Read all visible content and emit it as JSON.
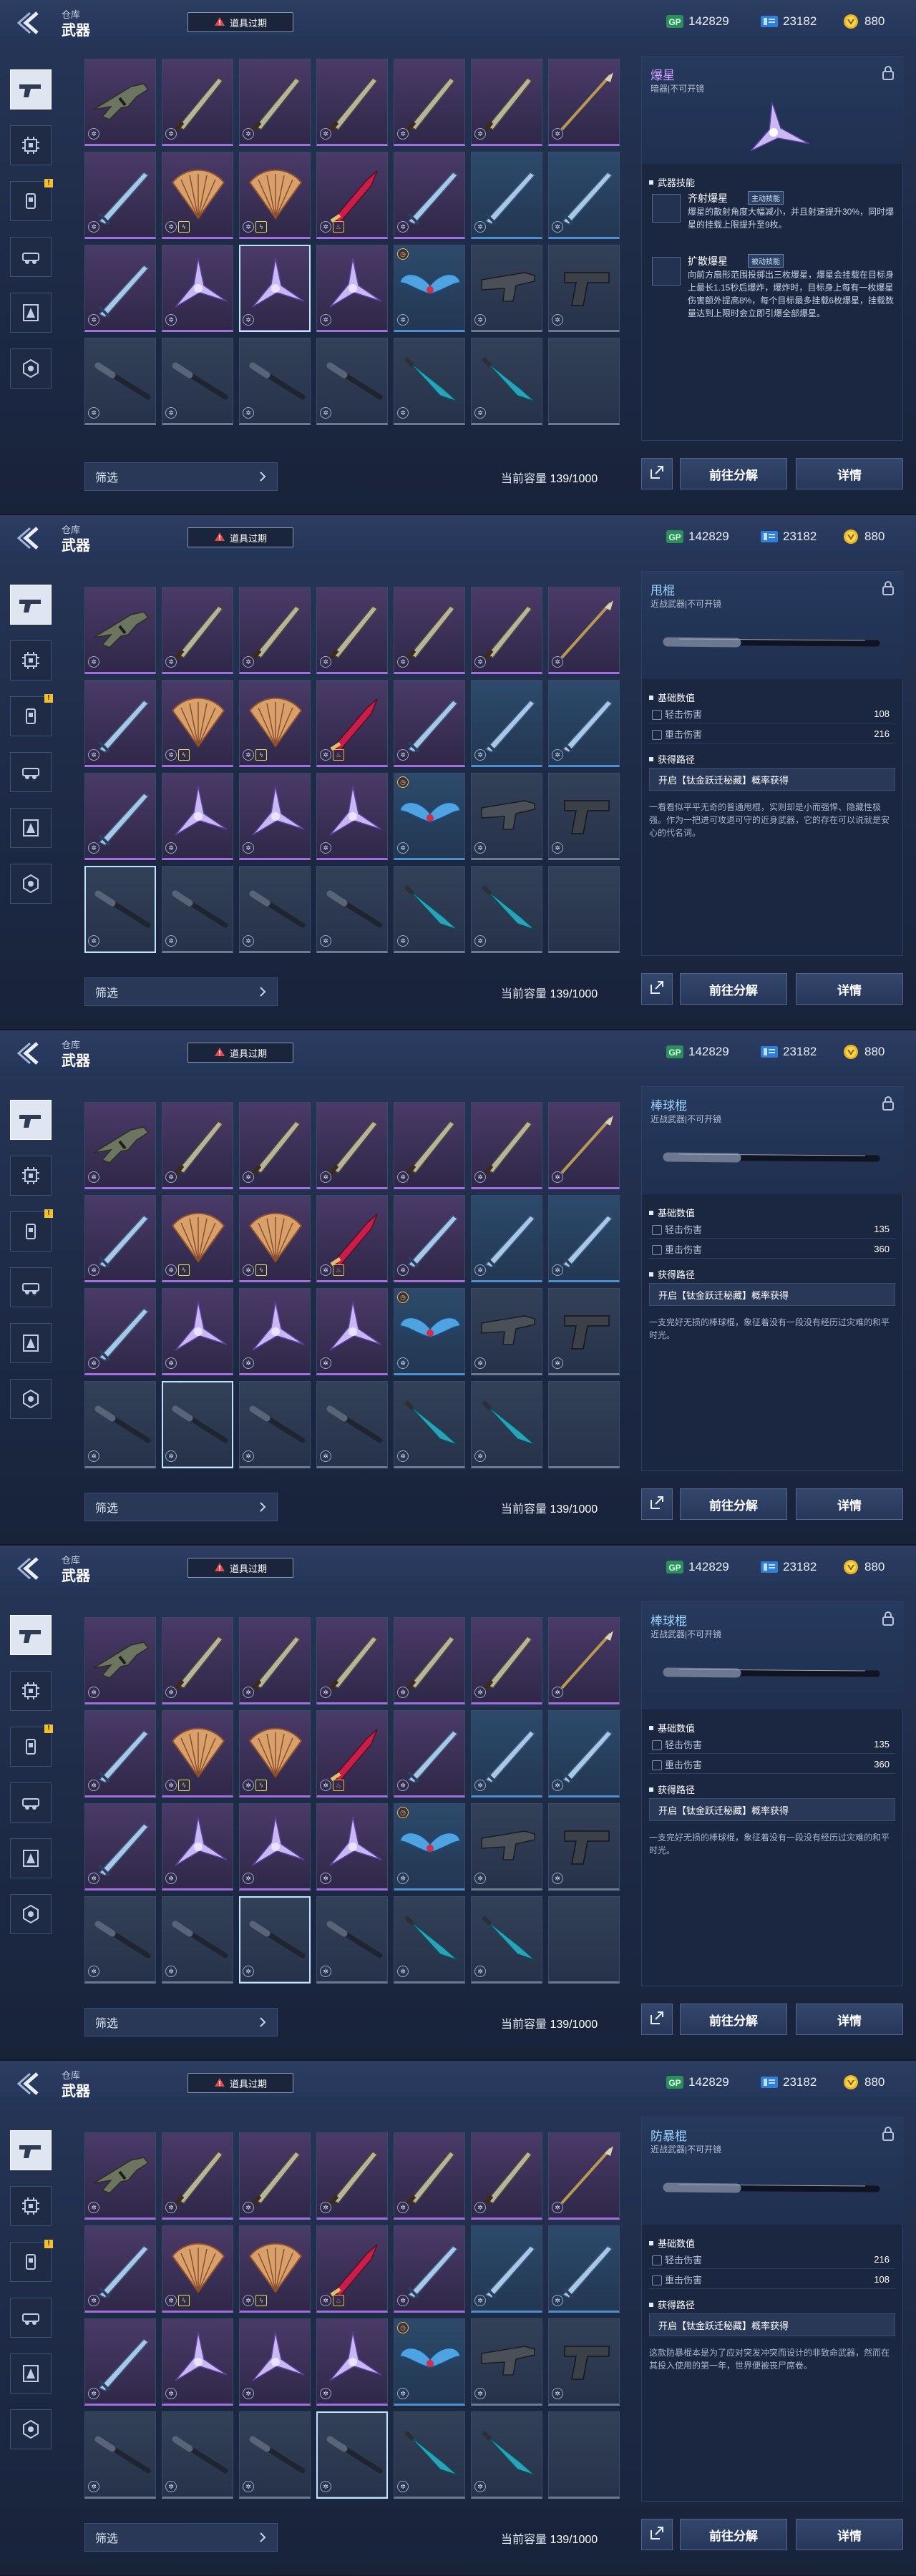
{
  "header": {
    "breadcrumb": "仓库",
    "title": "武器",
    "expire_label": "道具过期",
    "currencies": [
      {
        "icon": "gp-icon",
        "value": "142829"
      },
      {
        "icon": "ticket-icon",
        "value": "23182"
      },
      {
        "icon": "gold-coin-icon",
        "value": "880"
      }
    ]
  },
  "sidebar_tabs": [
    {
      "icon": "pistol-icon",
      "active": true,
      "alert": false
    },
    {
      "icon": "chip-icon",
      "active": false,
      "alert": false
    },
    {
      "icon": "consumable-icon",
      "active": false,
      "alert": true
    },
    {
      "icon": "vehicle-icon",
      "active": false,
      "alert": false
    },
    {
      "icon": "emblem-icon",
      "active": false,
      "alert": false
    },
    {
      "icon": "gear-badge-icon",
      "active": false,
      "alert": false
    }
  ],
  "filter_label": "筛选",
  "capacity_label": "当前容量",
  "capacity_value": "139/1000",
  "buttons": {
    "decompose": "前往分解",
    "details": "详情"
  },
  "screens": [
    {
      "selected_index": 16,
      "shifted": true,
      "detail": {
        "type": "skill",
        "name": "爆星",
        "subtitle": "暗器|不可开镜",
        "section": "武器技能",
        "skills": [
          {
            "name": "齐射爆星",
            "tag": "主动技能",
            "text": "爆星的散射角度大幅减小，并且射速提升30%，同时爆星的挂载上限提升至9枚。"
          },
          {
            "name": "扩散爆星",
            "tag": "被动技能",
            "text": "向前方扇形范围投掷出三枚爆星，爆星会挂载在目标身上最长1.15秒后爆炸，爆炸时，目标身上每有一枚爆星伤害额外提高8%，每个目标最多挂载6枚爆星，挂载数量达到上限时会立即引爆全部爆星。"
          }
        ]
      }
    },
    {
      "selected_index": 21,
      "shifted": false,
      "detail": {
        "type": "stats",
        "name": "甩棍",
        "subtitle": "近战武器|不可开镜",
        "base_label": "基础数值",
        "stats": [
          {
            "label": "轻击伤害",
            "value": "108"
          },
          {
            "label": "重击伤害",
            "value": "216"
          }
        ],
        "route_label": "获得路径",
        "route": "开启【钛金跃迁秘藏】概率获得",
        "desc": "一看看似平平无奇的普通甩棍，实则却是小而强悍、隐藏性极强。作为一把进可攻退可守的近身武器，它的存在可以说就是安心的代名词。"
      }
    },
    {
      "selected_index": 22,
      "shifted": false,
      "detail": {
        "type": "stats",
        "name": "棒球棍",
        "subtitle": "近战武器|不可开镜",
        "base_label": "基础数值",
        "stats": [
          {
            "label": "轻击伤害",
            "value": "135"
          },
          {
            "label": "重击伤害",
            "value": "360"
          }
        ],
        "route_label": "获得路径",
        "route": "开启【钛金跃迁秘藏】概率获得",
        "desc": "一支完好无损的棒球棍，象征着没有一段没有经历过灾难的和平时光。"
      }
    },
    {
      "selected_index": 23,
      "shifted": false,
      "detail": {
        "type": "stats",
        "name": "棒球棍",
        "subtitle": "近战武器|不可开镜",
        "base_label": "基础数值",
        "stats": [
          {
            "label": "轻击伤害",
            "value": "135"
          },
          {
            "label": "重击伤害",
            "value": "360"
          }
        ],
        "route_label": "获得路径",
        "route": "开启【钛金跃迁秘藏】概率获得",
        "desc": "一支完好无损的棒球棍，象征着没有一段没有经历过灾难的和平时光。"
      }
    },
    {
      "selected_index": 24,
      "shifted": false,
      "detail": {
        "type": "stats",
        "name": "防暴棍",
        "subtitle": "近战武器|不可开镜",
        "base_label": "基础数值",
        "stats": [
          {
            "label": "轻击伤害",
            "value": "216"
          },
          {
            "label": "重击伤害",
            "value": "108"
          }
        ],
        "route_label": "获得路径",
        "route": "开启【钛金跃迁秘藏】概率获得",
        "desc": "这款防暴棍本是为了应对突发冲突而设计的非致命武器，然而在其投入使用的第一年，世界便被丧尸席卷。"
      }
    }
  ],
  "items": [
    {
      "kind": "rifle",
      "rarity": "purple",
      "badge": "✲"
    },
    {
      "kind": "blade",
      "rarity": "purple",
      "badge": "✲"
    },
    {
      "kind": "blade",
      "rarity": "purple",
      "badge": "✲"
    },
    {
      "kind": "blade",
      "rarity": "purple",
      "badge": "✲"
    },
    {
      "kind": "blade",
      "rarity": "purple",
      "badge": "✲"
    },
    {
      "kind": "blade",
      "rarity": "purple",
      "badge": "✲"
    },
    {
      "kind": "spear",
      "rarity": "purple",
      "badge": "✲"
    },
    {
      "kind": "sword",
      "rarity": "purple",
      "badge": "✲"
    },
    {
      "kind": "fan",
      "rarity": "purple",
      "badge": "✲",
      "badge2": "⚡"
    },
    {
      "kind": "fan",
      "rarity": "purple",
      "badge": "✲",
      "badge2": "⚡"
    },
    {
      "kind": "dagger",
      "rarity": "purple",
      "badge": "✲",
      "badge2": "🔥"
    },
    {
      "kind": "sword",
      "rarity": "purple",
      "badge": "✲"
    },
    {
      "kind": "sword",
      "rarity": "blue",
      "badge": "✲"
    },
    {
      "kind": "sword",
      "rarity": "blue",
      "badge": "✲"
    },
    {
      "kind": "sword",
      "rarity": "purple",
      "badge": "✲"
    },
    {
      "kind": "star",
      "rarity": "purple",
      "badge": "✲"
    },
    {
      "kind": "star",
      "rarity": "purple",
      "badge": "✲"
    },
    {
      "kind": "star",
      "rarity": "purple",
      "badge": "✲"
    },
    {
      "kind": "wings",
      "rarity": "blue",
      "badge": "✲",
      "timer": true
    },
    {
      "kind": "gun",
      "rarity": "gray",
      "badge": "✲"
    },
    {
      "kind": "pistol",
      "rarity": "gray",
      "badge": "✲"
    },
    {
      "kind": "baton",
      "rarity": "gray",
      "badge": "✲"
    },
    {
      "kind": "baton",
      "rarity": "gray",
      "badge": "✲"
    },
    {
      "kind": "baton",
      "rarity": "gray",
      "badge": "✲"
    },
    {
      "kind": "baton",
      "rarity": "gray",
      "badge": "✲"
    },
    {
      "kind": "knife",
      "rarity": "gray",
      "badge": "✲"
    },
    {
      "kind": "knife",
      "rarity": "gray",
      "badge": "✲"
    },
    {
      "kind": "empty",
      "rarity": "gray",
      "badge": ""
    }
  ]
}
